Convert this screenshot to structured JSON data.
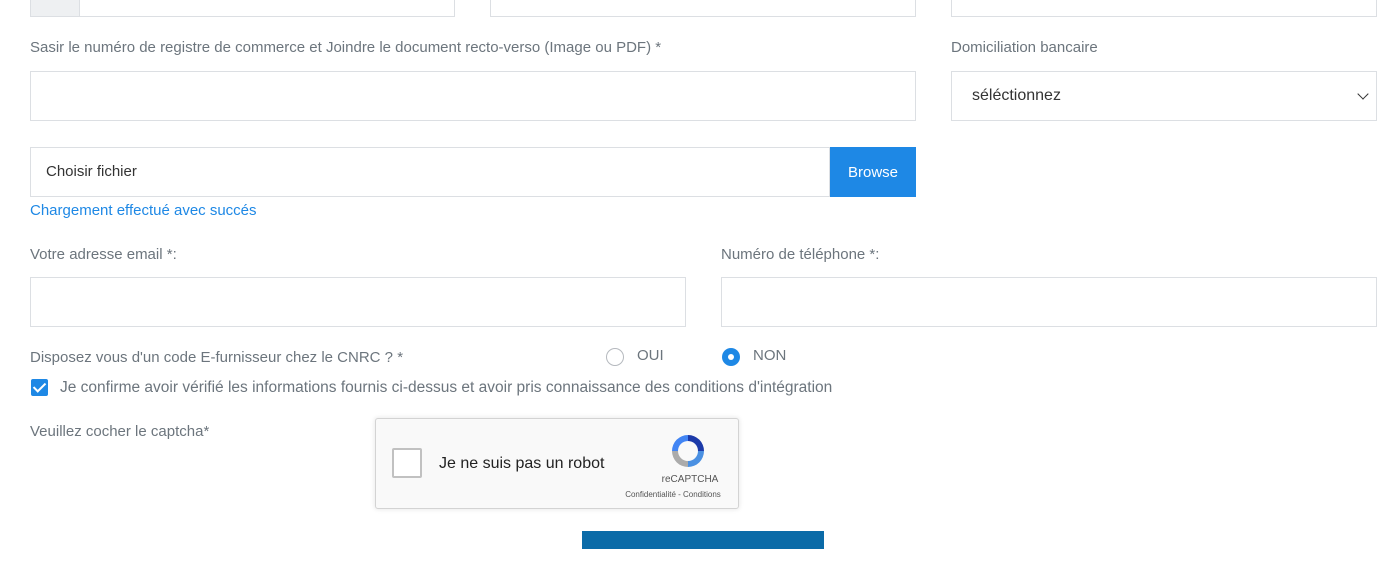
{
  "top_row": {},
  "registre": {
    "label": "Sasir le numéro de registre de commerce et Joindre le document recto-verso (Image ou PDF) *",
    "value": ""
  },
  "domiciliation": {
    "label": "Domiciliation bancaire",
    "selected": "séléctionnez"
  },
  "file_upload": {
    "placeholder": "Choisir fichier",
    "browse_label": "Browse",
    "status": "Chargement effectué avec succés"
  },
  "email": {
    "label": "Votre adresse email *:",
    "value": ""
  },
  "phone": {
    "label": "Numéro de téléphone *:",
    "value": ""
  },
  "efournisseur": {
    "question": "Disposez vous d'un code E-furnisseur chez le CNRC ? *",
    "options": [
      {
        "label": "OUI",
        "selected": false
      },
      {
        "label": "NON",
        "selected": true
      }
    ]
  },
  "confirm": {
    "label": "Je confirme avoir vérifié les informations fournis ci-dessus et avoir pris connaissance des conditions d'intégration",
    "checked": true
  },
  "captcha": {
    "label": "Veuillez cocher le captcha*",
    "checkbox_label": "Je ne suis pas un robot",
    "brand": "reCAPTCHA",
    "links": "Confidentialité - Conditions"
  },
  "colors": {
    "accent": "#1e88e5",
    "submit": "#0b6ba8",
    "label": "#6c757d",
    "border": "#dcdfe3"
  }
}
